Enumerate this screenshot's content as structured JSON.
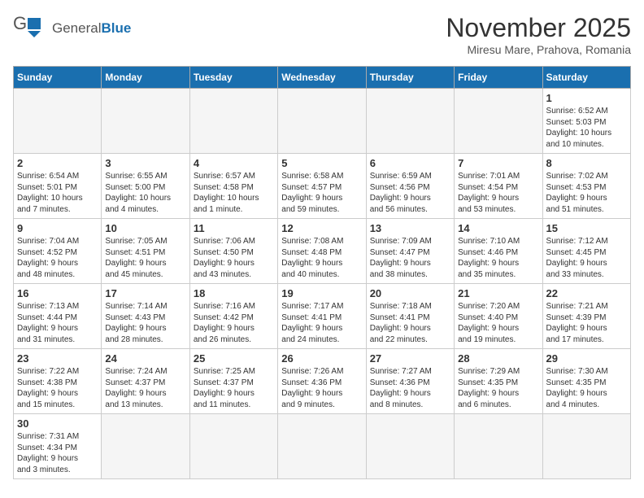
{
  "header": {
    "logo_general": "General",
    "logo_blue": "Blue",
    "title": "November 2025",
    "location": "Miresu Mare, Prahova, Romania"
  },
  "days_of_week": [
    "Sunday",
    "Monday",
    "Tuesday",
    "Wednesday",
    "Thursday",
    "Friday",
    "Saturday"
  ],
  "weeks": [
    [
      {
        "day": "",
        "info": ""
      },
      {
        "day": "",
        "info": ""
      },
      {
        "day": "",
        "info": ""
      },
      {
        "day": "",
        "info": ""
      },
      {
        "day": "",
        "info": ""
      },
      {
        "day": "",
        "info": ""
      },
      {
        "day": "1",
        "info": "Sunrise: 6:52 AM\nSunset: 5:03 PM\nDaylight: 10 hours\nand 10 minutes."
      }
    ],
    [
      {
        "day": "2",
        "info": "Sunrise: 6:54 AM\nSunset: 5:01 PM\nDaylight: 10 hours\nand 7 minutes."
      },
      {
        "day": "3",
        "info": "Sunrise: 6:55 AM\nSunset: 5:00 PM\nDaylight: 10 hours\nand 4 minutes."
      },
      {
        "day": "4",
        "info": "Sunrise: 6:57 AM\nSunset: 4:58 PM\nDaylight: 10 hours\nand 1 minute."
      },
      {
        "day": "5",
        "info": "Sunrise: 6:58 AM\nSunset: 4:57 PM\nDaylight: 9 hours\nand 59 minutes."
      },
      {
        "day": "6",
        "info": "Sunrise: 6:59 AM\nSunset: 4:56 PM\nDaylight: 9 hours\nand 56 minutes."
      },
      {
        "day": "7",
        "info": "Sunrise: 7:01 AM\nSunset: 4:54 PM\nDaylight: 9 hours\nand 53 minutes."
      },
      {
        "day": "8",
        "info": "Sunrise: 7:02 AM\nSunset: 4:53 PM\nDaylight: 9 hours\nand 51 minutes."
      }
    ],
    [
      {
        "day": "9",
        "info": "Sunrise: 7:04 AM\nSunset: 4:52 PM\nDaylight: 9 hours\nand 48 minutes."
      },
      {
        "day": "10",
        "info": "Sunrise: 7:05 AM\nSunset: 4:51 PM\nDaylight: 9 hours\nand 45 minutes."
      },
      {
        "day": "11",
        "info": "Sunrise: 7:06 AM\nSunset: 4:50 PM\nDaylight: 9 hours\nand 43 minutes."
      },
      {
        "day": "12",
        "info": "Sunrise: 7:08 AM\nSunset: 4:48 PM\nDaylight: 9 hours\nand 40 minutes."
      },
      {
        "day": "13",
        "info": "Sunrise: 7:09 AM\nSunset: 4:47 PM\nDaylight: 9 hours\nand 38 minutes."
      },
      {
        "day": "14",
        "info": "Sunrise: 7:10 AM\nSunset: 4:46 PM\nDaylight: 9 hours\nand 35 minutes."
      },
      {
        "day": "15",
        "info": "Sunrise: 7:12 AM\nSunset: 4:45 PM\nDaylight: 9 hours\nand 33 minutes."
      }
    ],
    [
      {
        "day": "16",
        "info": "Sunrise: 7:13 AM\nSunset: 4:44 PM\nDaylight: 9 hours\nand 31 minutes."
      },
      {
        "day": "17",
        "info": "Sunrise: 7:14 AM\nSunset: 4:43 PM\nDaylight: 9 hours\nand 28 minutes."
      },
      {
        "day": "18",
        "info": "Sunrise: 7:16 AM\nSunset: 4:42 PM\nDaylight: 9 hours\nand 26 minutes."
      },
      {
        "day": "19",
        "info": "Sunrise: 7:17 AM\nSunset: 4:41 PM\nDaylight: 9 hours\nand 24 minutes."
      },
      {
        "day": "20",
        "info": "Sunrise: 7:18 AM\nSunset: 4:41 PM\nDaylight: 9 hours\nand 22 minutes."
      },
      {
        "day": "21",
        "info": "Sunrise: 7:20 AM\nSunset: 4:40 PM\nDaylight: 9 hours\nand 19 minutes."
      },
      {
        "day": "22",
        "info": "Sunrise: 7:21 AM\nSunset: 4:39 PM\nDaylight: 9 hours\nand 17 minutes."
      }
    ],
    [
      {
        "day": "23",
        "info": "Sunrise: 7:22 AM\nSunset: 4:38 PM\nDaylight: 9 hours\nand 15 minutes."
      },
      {
        "day": "24",
        "info": "Sunrise: 7:24 AM\nSunset: 4:37 PM\nDaylight: 9 hours\nand 13 minutes."
      },
      {
        "day": "25",
        "info": "Sunrise: 7:25 AM\nSunset: 4:37 PM\nDaylight: 9 hours\nand 11 minutes."
      },
      {
        "day": "26",
        "info": "Sunrise: 7:26 AM\nSunset: 4:36 PM\nDaylight: 9 hours\nand 9 minutes."
      },
      {
        "day": "27",
        "info": "Sunrise: 7:27 AM\nSunset: 4:36 PM\nDaylight: 9 hours\nand 8 minutes."
      },
      {
        "day": "28",
        "info": "Sunrise: 7:29 AM\nSunset: 4:35 PM\nDaylight: 9 hours\nand 6 minutes."
      },
      {
        "day": "29",
        "info": "Sunrise: 7:30 AM\nSunset: 4:35 PM\nDaylight: 9 hours\nand 4 minutes."
      }
    ],
    [
      {
        "day": "30",
        "info": "Sunrise: 7:31 AM\nSunset: 4:34 PM\nDaylight: 9 hours\nand 3 minutes."
      },
      {
        "day": "",
        "info": ""
      },
      {
        "day": "",
        "info": ""
      },
      {
        "day": "",
        "info": ""
      },
      {
        "day": "",
        "info": ""
      },
      {
        "day": "",
        "info": ""
      },
      {
        "day": "",
        "info": ""
      }
    ]
  ]
}
